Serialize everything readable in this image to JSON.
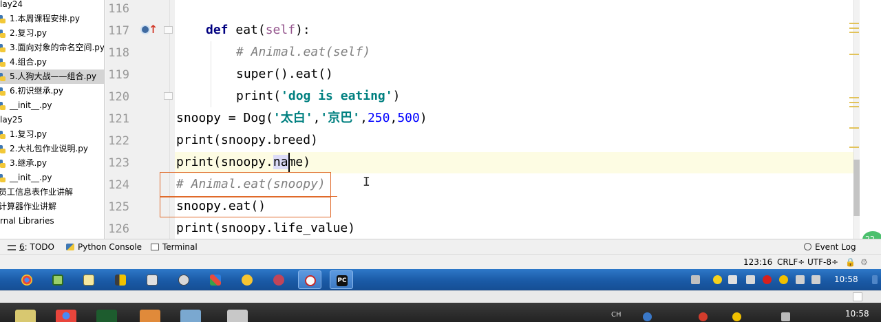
{
  "project_tree": {
    "items": [
      {
        "label": "lay24",
        "type": "folder"
      },
      {
        "label": "1.本周课程安排.py",
        "type": "file"
      },
      {
        "label": "2.复习.py",
        "type": "file"
      },
      {
        "label": "3.面向对象的命名空间.py",
        "type": "file"
      },
      {
        "label": "4.组合.py",
        "type": "file"
      },
      {
        "label": "5.人狗大战——组合.py",
        "type": "file",
        "selected": true
      },
      {
        "label": "6.初识继承.py",
        "type": "file"
      },
      {
        "label": "__init__.py",
        "type": "file"
      },
      {
        "label": "lay25",
        "type": "folder"
      },
      {
        "label": "1.复习.py",
        "type": "file"
      },
      {
        "label": "2.大礼包作业说明.py",
        "type": "file"
      },
      {
        "label": "3.继承.py",
        "type": "file"
      },
      {
        "label": "__init__.py",
        "type": "file"
      },
      {
        "label": "员工信息表作业讲解",
        "type": "folder"
      },
      {
        "label": "计算器作业讲解",
        "type": "folder"
      },
      {
        "label": "rnal Libraries",
        "type": "folder"
      }
    ]
  },
  "editor": {
    "line_numbers": [
      "116",
      "117",
      "118",
      "119",
      "120",
      "121",
      "122",
      "123",
      "124",
      "125",
      "126"
    ],
    "lines": {
      "l117": {
        "kw": "def",
        "name": " eat(",
        "self": "self",
        "end": "):"
      },
      "l118": {
        "comment": "# Animal.eat(self)"
      },
      "l119": {
        "text": "super().eat()"
      },
      "l120": {
        "pre": "print(",
        "str": "'dog is eating'",
        "post": ")"
      },
      "l121": {
        "pre": "snoopy = Dog(",
        "s1": "'太白'",
        "c1": ",",
        "s2": "'京巴'",
        "c2": ",",
        "n1": "250",
        "c3": ",",
        "n2": "500",
        "post": ")"
      },
      "l122": {
        "text": "print(snoopy.breed)"
      },
      "l123": {
        "pre": "print(snoopy.",
        "sel": "na",
        "post": "me)"
      },
      "l124": {
        "comment": "# Animal.eat(snoopy)"
      },
      "l125": {
        "text": "snoopy.eat()"
      },
      "l126": {
        "text": "print(snoopy.life_value)"
      }
    },
    "colors": {
      "keyword": "#000080",
      "string": "#008080",
      "number": "#0000ff",
      "comment": "#808080",
      "self": "#94558d",
      "annotation": "#e06a2a"
    }
  },
  "tool_windows": {
    "todo_number": "6",
    "todo_rest": ": TODO",
    "python_console": "Python Console",
    "terminal": "Terminal",
    "event_log": "Event Log"
  },
  "status_bar": {
    "position": "123:16",
    "line_separator": "CRLF÷",
    "encoding": "UTF-8÷",
    "side_badge": "22"
  },
  "taskbar": {
    "clock": "10:58",
    "apps": [
      "chrome",
      "app-2",
      "notepad",
      "app-4",
      "app-5",
      "app-6",
      "app-7",
      "app-8",
      "app-9",
      "app-10",
      "pycharm"
    ],
    "active_app": "pycharm"
  },
  "taskbar_lower": {
    "clock": "10:58",
    "tray_text": "CH"
  }
}
